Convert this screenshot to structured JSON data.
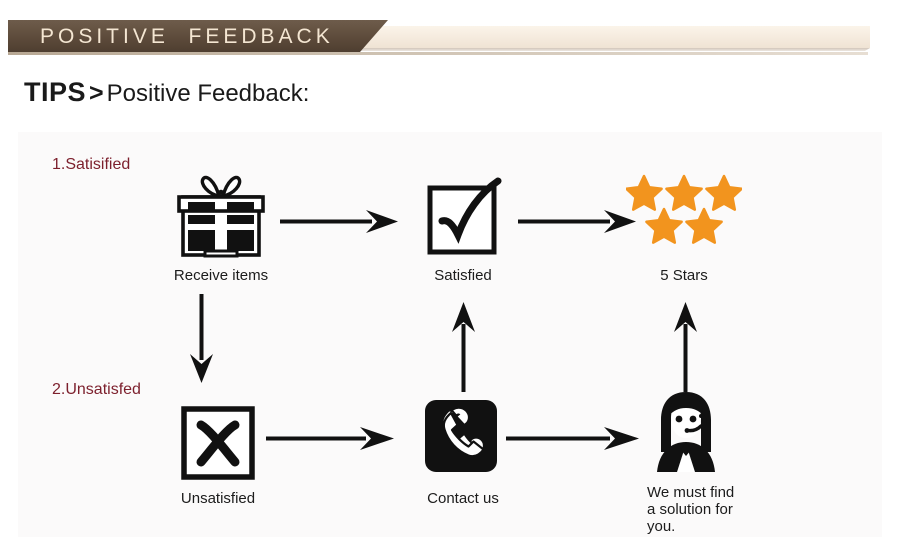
{
  "banner": {
    "title": "POSITIVE  FEEDBACK",
    "brown_color": "#5d4b3b",
    "cream_color": "#f6ece0",
    "title_color": "#f4e6d2"
  },
  "heading": {
    "tips": "TIPS",
    "separator": ">",
    "subject": "Positive Feedback:"
  },
  "diagram": {
    "background_color": "#fbfafa",
    "steps": [
      {
        "id": "step-1",
        "label": "1.Satisified",
        "color": "#7c1f2c"
      },
      {
        "id": "step-2",
        "label": "2.Unsatisfed",
        "color": "#7c1f2c"
      }
    ],
    "nodes": [
      {
        "id": "receive-items",
        "label": "Receive items",
        "icon": "gift-box-icon"
      },
      {
        "id": "satisfied",
        "label": "Satisfied",
        "icon": "check-box-icon"
      },
      {
        "id": "five-stars",
        "label": "5 Stars",
        "icon": "five-stars-icon",
        "star_count": 5,
        "star_color": "#f2941e"
      },
      {
        "id": "unsatisfied",
        "label": "Unsatisfied",
        "icon": "x-box-icon"
      },
      {
        "id": "contact-us",
        "label": "Contact us",
        "icon": "phone-icon"
      },
      {
        "id": "support-agent",
        "label": "We must find\na solution for\nyou.",
        "icon": "headset-agent-icon"
      }
    ],
    "arrows": [
      {
        "id": "arrow-receive-to-satisfied",
        "direction": "right"
      },
      {
        "id": "arrow-satisfied-to-stars",
        "direction": "right"
      },
      {
        "id": "arrow-receive-to-unsatisfied",
        "direction": "down"
      },
      {
        "id": "arrow-contact-to-satisfied",
        "direction": "up"
      },
      {
        "id": "arrow-unsatisfied-to-contact",
        "direction": "right"
      },
      {
        "id": "arrow-contact-to-agent",
        "direction": "right"
      },
      {
        "id": "arrow-agent-to-stars",
        "direction": "up"
      }
    ],
    "arrow_color": "#111111"
  }
}
